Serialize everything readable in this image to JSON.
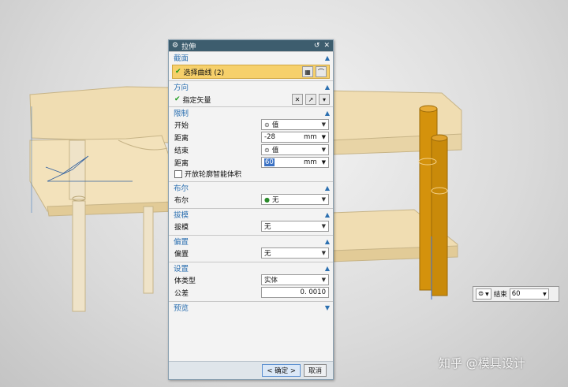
{
  "dialog": {
    "title": "拉伸",
    "section_section": "截面",
    "select_curve": "选择曲线 (2)",
    "section_direction": "方向",
    "specify_vector": "指定矢量",
    "section_limits": "限制",
    "start_label": "开始",
    "start_type": "值",
    "distance_label": "距离",
    "start_distance": "-28",
    "unit": "mm",
    "end_label": "结束",
    "end_type": "值",
    "end_distance": "60",
    "open_profile": "开放轮廓智能体积",
    "section_boolean": "布尔",
    "boolean_label": "布尔",
    "boolean_value": "无",
    "section_draft": "拔模",
    "draft_label": "拔模",
    "draft_value": "无",
    "section_offset": "偏置",
    "offset_label": "偏置",
    "offset_value": "无",
    "section_settings": "设置",
    "body_type_label": "体类型",
    "body_type_value": "实体",
    "tolerance_label": "公差",
    "tolerance_value": "0. 0010",
    "section_preview": "预览",
    "ok_button": "< 确定 >",
    "cancel_button": "取消"
  },
  "floating": {
    "end_label": "结束",
    "end_value": "60"
  },
  "watermark": "知乎 @模具设计",
  "colors": {
    "title_bar": "#3d5d6e",
    "section_text": "#2b6fb0",
    "selection_highlight": "#f6d06b",
    "model_wood": "#f0ddb2",
    "cylinder": "#d4920c"
  },
  "icons": {
    "dialog": "gear-icon",
    "reset": "reset-icon",
    "close": "close-icon",
    "collapse": "chevron-up-icon",
    "expand": "chevron-down-icon",
    "check": "check-icon"
  }
}
